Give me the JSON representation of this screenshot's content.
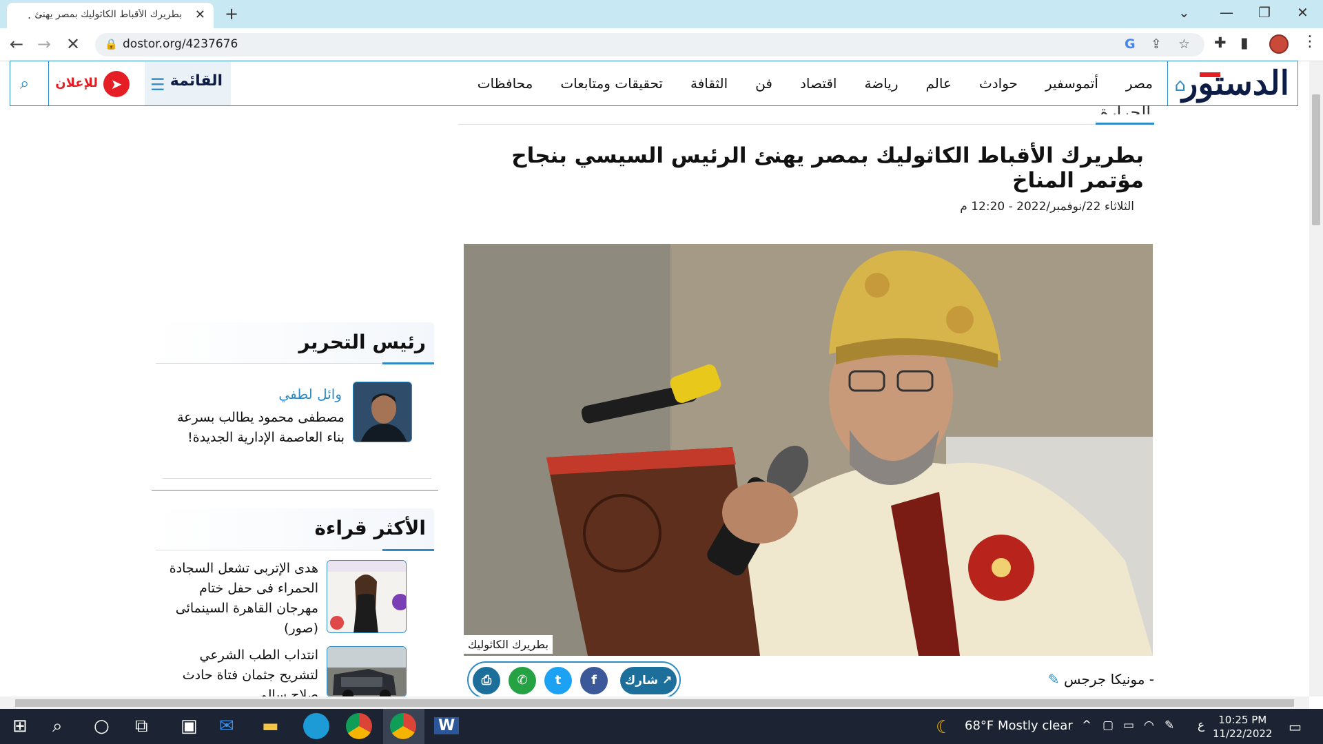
{
  "browser": {
    "tab_title": "بطريرك الأقباط الكاثوليك بمصر يهنئ",
    "tab_loading_dot": ".",
    "url": "dostor.org/4237676"
  },
  "site": {
    "logo": "الدستور",
    "nav": [
      "مصر",
      "أتموسفير",
      "حوادث",
      "عالم",
      "رياضة",
      "اقتصاد",
      "فن",
      "الثقافة",
      "تحقيقات ومتابعات",
      "محافظات"
    ],
    "menu_label": "القائمة",
    "advert_label": "للإعلان"
  },
  "article": {
    "category": "الحرارة",
    "headline": "بطريرك الأقباط الكاثوليك بمصر يهنئ الرئيس السيسي بنجاح مؤتمر المناخ",
    "date": "الثلاثاء 22/نوفمبر/2022 - 12:20 م",
    "image_caption": "بطريرك الكاثوليك",
    "author": "- مونيكا جرجس",
    "share_label": "شارك"
  },
  "sidebar": {
    "editor_section_title": "رئيس التحرير",
    "editor_name": "وائل لطفي",
    "editor_article": "مصطفى محمود يطالب بسرعة بناء العاصمة الإدارية الجديدة!",
    "most_read_title": "الأكثر قراءة",
    "most_read": [
      {
        "title": "هدى الإتربى تشعل السجادة الحمراء فى حفل ختام مهرجان القاهرة السينمائى (صور)"
      },
      {
        "title": "انتداب الطب الشرعي لتشريح جثمان فتاة حادث صلاح سالم"
      }
    ]
  },
  "taskbar": {
    "weather": "68°F  Mostly clear",
    "time": "10:25 PM",
    "date": "11/22/2022",
    "lang": "ع"
  }
}
